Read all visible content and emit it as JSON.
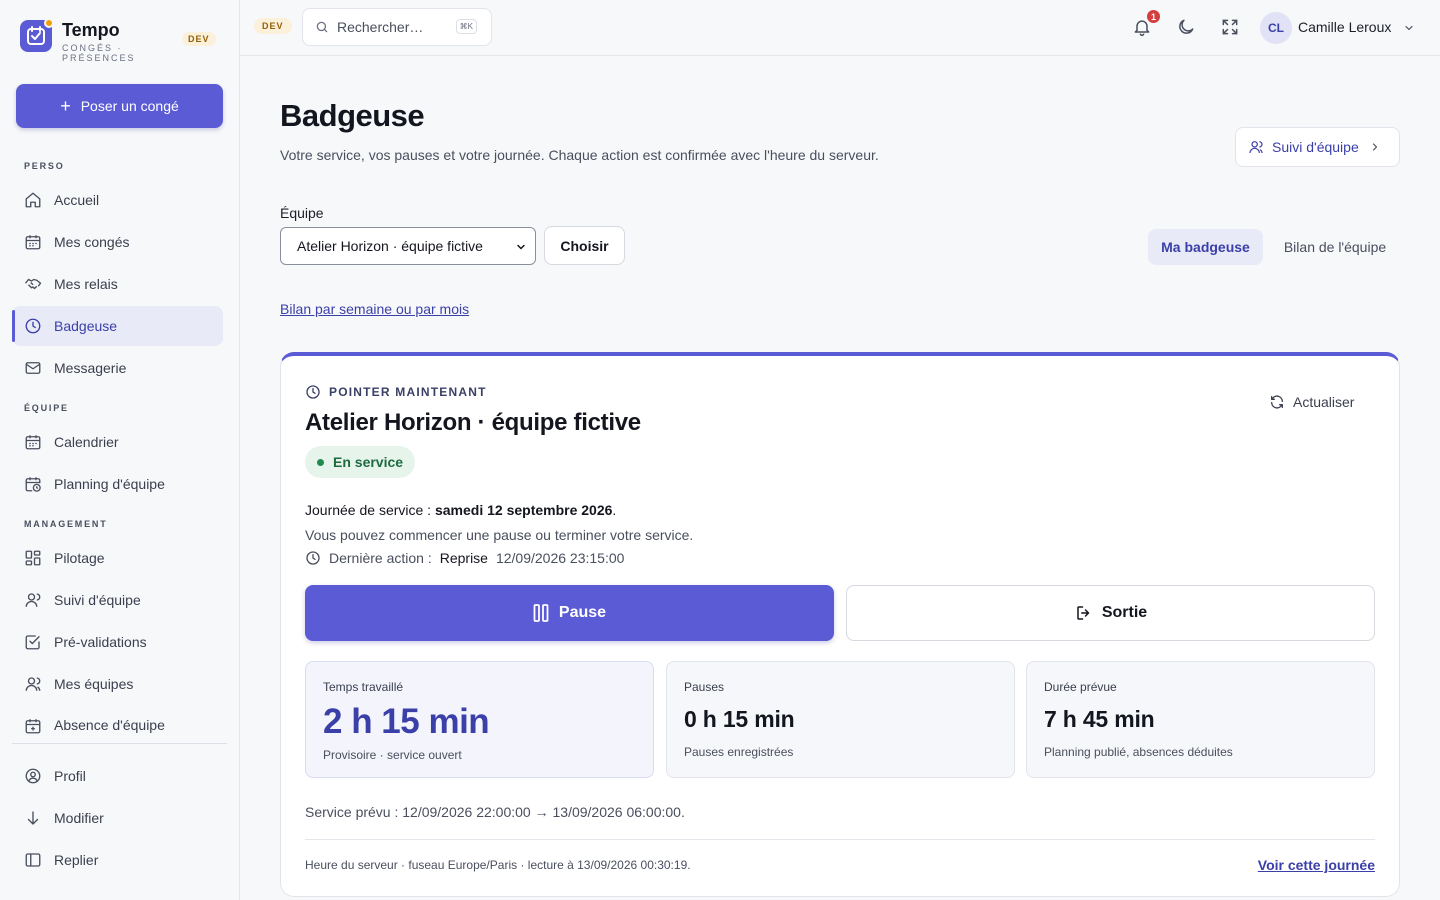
{
  "brand": {
    "name": "Tempo",
    "subtitle": "CONGÉS · PRÉSENCES",
    "env": "DEV"
  },
  "sidebar": {
    "cta_label": "Poser un congé",
    "sections": {
      "perso": "PERSO",
      "equipe": "ÉQUIPE",
      "management": "MANAGEMENT"
    },
    "items": [
      {
        "label": "Accueil",
        "icon": "home-icon"
      },
      {
        "label": "Mes congés",
        "icon": "calendar-icon"
      },
      {
        "label": "Mes relais",
        "icon": "handshake-icon"
      },
      {
        "label": "Badgeuse",
        "icon": "clock-icon",
        "active": true
      },
      {
        "label": "Messagerie",
        "icon": "mail-icon"
      },
      {
        "label": "Calendrier",
        "icon": "calendar-icon"
      },
      {
        "label": "Planning d'équipe",
        "icon": "calendar-clock-icon"
      },
      {
        "label": "Pilotage",
        "icon": "dashboard-icon"
      },
      {
        "label": "Suivi d'équipe",
        "icon": "user-icon"
      },
      {
        "label": "Pré-validations",
        "icon": "check-square-icon"
      },
      {
        "label": "Mes équipes",
        "icon": "users-icon"
      },
      {
        "label": "Absence d'équipe",
        "icon": "calendar-plus-icon"
      }
    ],
    "bottom": [
      {
        "label": "Profil",
        "icon": "user-circle-icon"
      },
      {
        "label": "Modifier",
        "icon": "arrow-down-icon"
      },
      {
        "label": "Replier",
        "icon": "sidebar-icon"
      }
    ]
  },
  "topbar": {
    "env": "DEV",
    "search_placeholder": "Rechercher…",
    "search_shortcut": "⌘K",
    "notifications_count": "1",
    "user_initials": "CL",
    "user_name": "Camille Leroux"
  },
  "page": {
    "title": "Badgeuse",
    "subtitle": "Votre service, vos pauses et votre journée. Chaque action est confirmée avec l'heure du serveur.",
    "team_follow_label": "Suivi d'équipe",
    "team_label": "Équipe",
    "team_selected": "Atelier Horizon · équipe fictive",
    "choose_label": "Choisir",
    "tabs": [
      {
        "label": "Ma badgeuse",
        "active": true
      },
      {
        "label": "Bilan de l'équipe",
        "active": false
      }
    ],
    "bilan_link": "Bilan par semaine ou par mois"
  },
  "card": {
    "kicker": "POINTER MAINTENANT",
    "refresh_label": "Actualiser",
    "title": "Atelier Horizon · équipe fictive",
    "status": "En service",
    "status_color": "#1f8a4c",
    "day_prefix": "Journée de service : ",
    "day_value": "samedi 12 septembre 2026",
    "day_suffix": ".",
    "hint": "Vous pouvez commencer une pause ou terminer votre service.",
    "last_action_label": "Dernière action :",
    "last_action_kind": "Reprise",
    "last_action_time": "12/09/2026 23:15:00",
    "pause_label": "Pause",
    "exit_label": "Sortie",
    "stats": [
      {
        "label": "Temps travaillé",
        "value": "2 h 15 min",
        "note": "Provisoire · service ouvert"
      },
      {
        "label": "Pauses",
        "value": "0 h 15 min",
        "note": "Pauses enregistrées"
      },
      {
        "label": "Durée prévue",
        "value": "7 h 45 min",
        "note": "Planning publié, absences déduites"
      }
    ],
    "planned": "Service prévu : 12/09/2026 22:00:00 → 13/09/2026 06:00:00.",
    "footer_note": "Heure du serveur · fuseau Europe/Paris · lecture à 13/09/2026 00:30:19.",
    "view_day_link": "Voir cette journée"
  },
  "colors": {
    "accent": "#5b5bd6",
    "accent_text": "#3b3fa8",
    "success_bg": "#e6f4ec"
  }
}
